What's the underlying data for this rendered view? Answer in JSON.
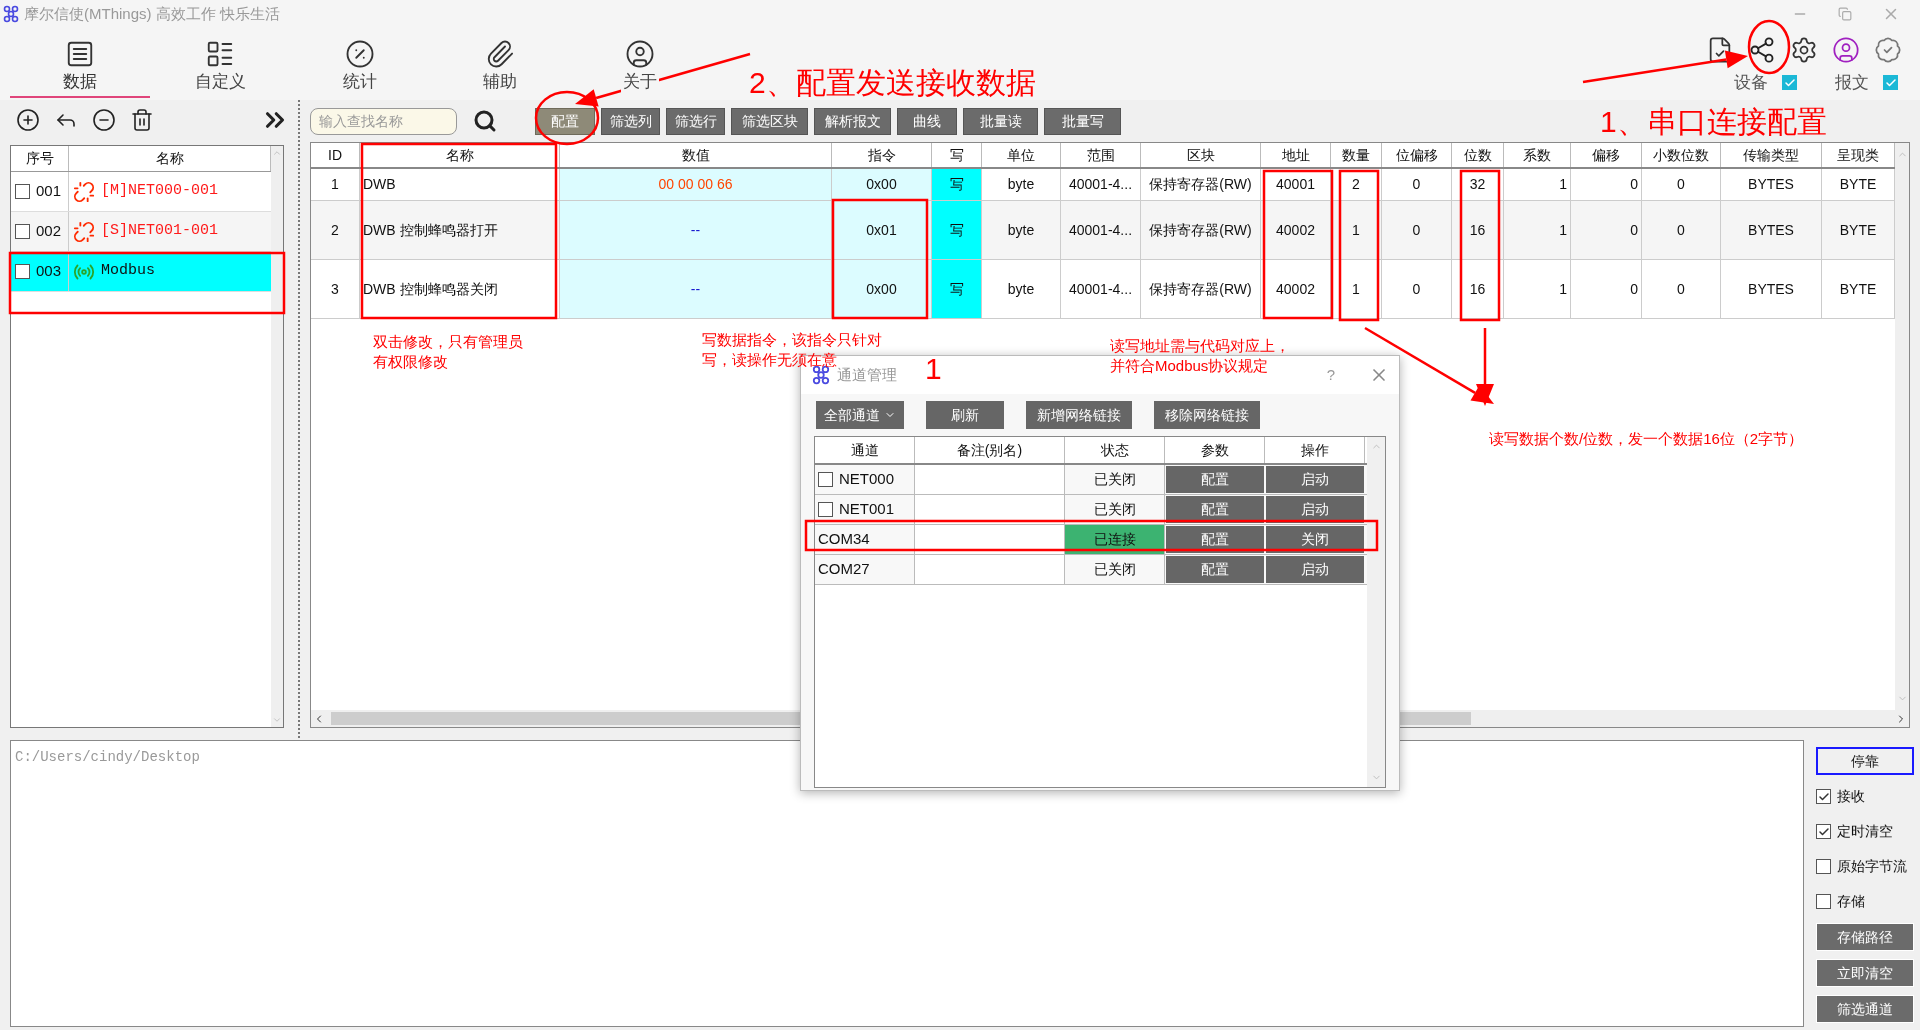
{
  "window": {
    "title": "摩尔信使(MThings) 高效工作 快乐生活"
  },
  "nav_tabs": [
    {
      "label": "数据",
      "selected": true
    },
    {
      "label": "自定义",
      "selected": false
    },
    {
      "label": "统计",
      "selected": false
    },
    {
      "label": "辅助",
      "selected": false
    },
    {
      "label": "关于",
      "selected": false
    }
  ],
  "header_toggles": [
    {
      "label": "设备",
      "checked": true
    },
    {
      "label": "报文",
      "checked": true
    }
  ],
  "channel_list": {
    "columns": [
      "序号",
      "名称"
    ],
    "rows": [
      {
        "index": "001",
        "name": "[M]NET000-001",
        "kind": "disconnected",
        "checked": false,
        "selected": false
      },
      {
        "index": "002",
        "name": "[S]NET001-001",
        "kind": "disconnected",
        "checked": false,
        "selected": false
      },
      {
        "index": "003",
        "name": "Modbus",
        "kind": "connected",
        "checked": false,
        "selected": true
      }
    ]
  },
  "search": {
    "placeholder": "输入查找名称"
  },
  "toolbar_buttons": [
    {
      "label": "配置",
      "selected": true
    },
    {
      "label": "筛选列",
      "selected": false
    },
    {
      "label": "筛选行",
      "selected": false
    },
    {
      "label": "筛选区块",
      "selected": false
    },
    {
      "label": "解析报文",
      "selected": false
    },
    {
      "label": "曲线",
      "selected": false
    },
    {
      "label": "批量读",
      "selected": false
    },
    {
      "label": "批量写",
      "selected": false
    }
  ],
  "table": {
    "columns": [
      "ID",
      "名称",
      "数值",
      "指令",
      "写",
      "单位",
      "范围",
      "区块",
      "地址",
      "数量",
      "位偏移",
      "位数",
      "系数",
      "偏移",
      "小数位数",
      "传输类型",
      "呈现类"
    ],
    "rows": [
      {
        "updated": true,
        "cells": [
          "1",
          "DWB",
          "00 00 00 66",
          "0x00",
          "写",
          "byte",
          "40001-4...",
          "保持寄存器(RW)",
          "40001",
          "2",
          "0",
          "32",
          "1",
          "0",
          "0",
          "BYTES",
          "BYTE"
        ]
      },
      {
        "updated": false,
        "cells": [
          "2",
          "DWB 控制蜂鸣器打开",
          "--",
          "0x01",
          "写",
          "byte",
          "40001-4...",
          "保持寄存器(RW)",
          "40002",
          "1",
          "0",
          "16",
          "1",
          "0",
          "0",
          "BYTES",
          "BYTE"
        ]
      },
      {
        "updated": false,
        "cells": [
          "3",
          "DWB 控制蜂鸣器关闭",
          "--",
          "0x00",
          "写",
          "byte",
          "40001-4...",
          "保持寄存器(RW)",
          "40002",
          "1",
          "0",
          "16",
          "1",
          "0",
          "0",
          "BYTES",
          "BYTE"
        ]
      }
    ]
  },
  "log": {
    "path": "C:/Users/cindy/Desktop"
  },
  "side_controls": [
    {
      "kind": "button",
      "label": "停靠",
      "focused": true
    },
    {
      "kind": "checkbox",
      "label": "接收",
      "checked": true
    },
    {
      "kind": "checkbox",
      "label": "定时清空",
      "checked": true
    },
    {
      "kind": "checkbox",
      "label": "原始字节流",
      "checked": false
    },
    {
      "kind": "checkbox",
      "label": "存储",
      "checked": false
    },
    {
      "kind": "button",
      "label": "存储路径",
      "focused": false
    },
    {
      "kind": "button",
      "label": "立即清空",
      "focused": false
    },
    {
      "kind": "button",
      "label": "筛选通道",
      "focused": false
    }
  ],
  "dialog": {
    "title": "通道管理",
    "help": "?",
    "filter": "全部通道",
    "buttons": [
      "刷新",
      "新增网络链接",
      "移除网络链接"
    ],
    "columns": [
      "通道",
      "备注(别名)",
      "状态",
      "参数",
      "操作"
    ],
    "rows": [
      {
        "channel": "NET000",
        "kind": "network",
        "checked": false,
        "status": "已关闭",
        "connected": false,
        "config": "配置",
        "action": "启动"
      },
      {
        "channel": "NET001",
        "kind": "network",
        "checked": false,
        "status": "已关闭",
        "connected": false,
        "config": "配置",
        "action": "启动"
      },
      {
        "channel": "COM34",
        "kind": "serial",
        "status": "已连接",
        "connected": true,
        "config": "配置",
        "action": "关闭"
      },
      {
        "channel": "COM27",
        "kind": "serial",
        "status": "已关闭",
        "connected": false,
        "config": "配置",
        "action": "启动"
      }
    ]
  },
  "annotations": [
    {
      "kind": "heading",
      "text": "2、配置发送接收数据"
    },
    {
      "kind": "heading",
      "text": "1、串口连接配置"
    },
    {
      "kind": "note",
      "text": "双击修改，只有管理员有权限修改"
    },
    {
      "kind": "note",
      "text": "写数据指令，该指令只针对写，读操作无须在意"
    },
    {
      "kind": "note",
      "text": "读写地址需与代码对应上，并符合Modbus协议规定"
    },
    {
      "kind": "note",
      "text": "读写数据个数/位数，发一个数据16位（2字节）"
    },
    {
      "kind": "heading",
      "text": "1"
    }
  ]
}
